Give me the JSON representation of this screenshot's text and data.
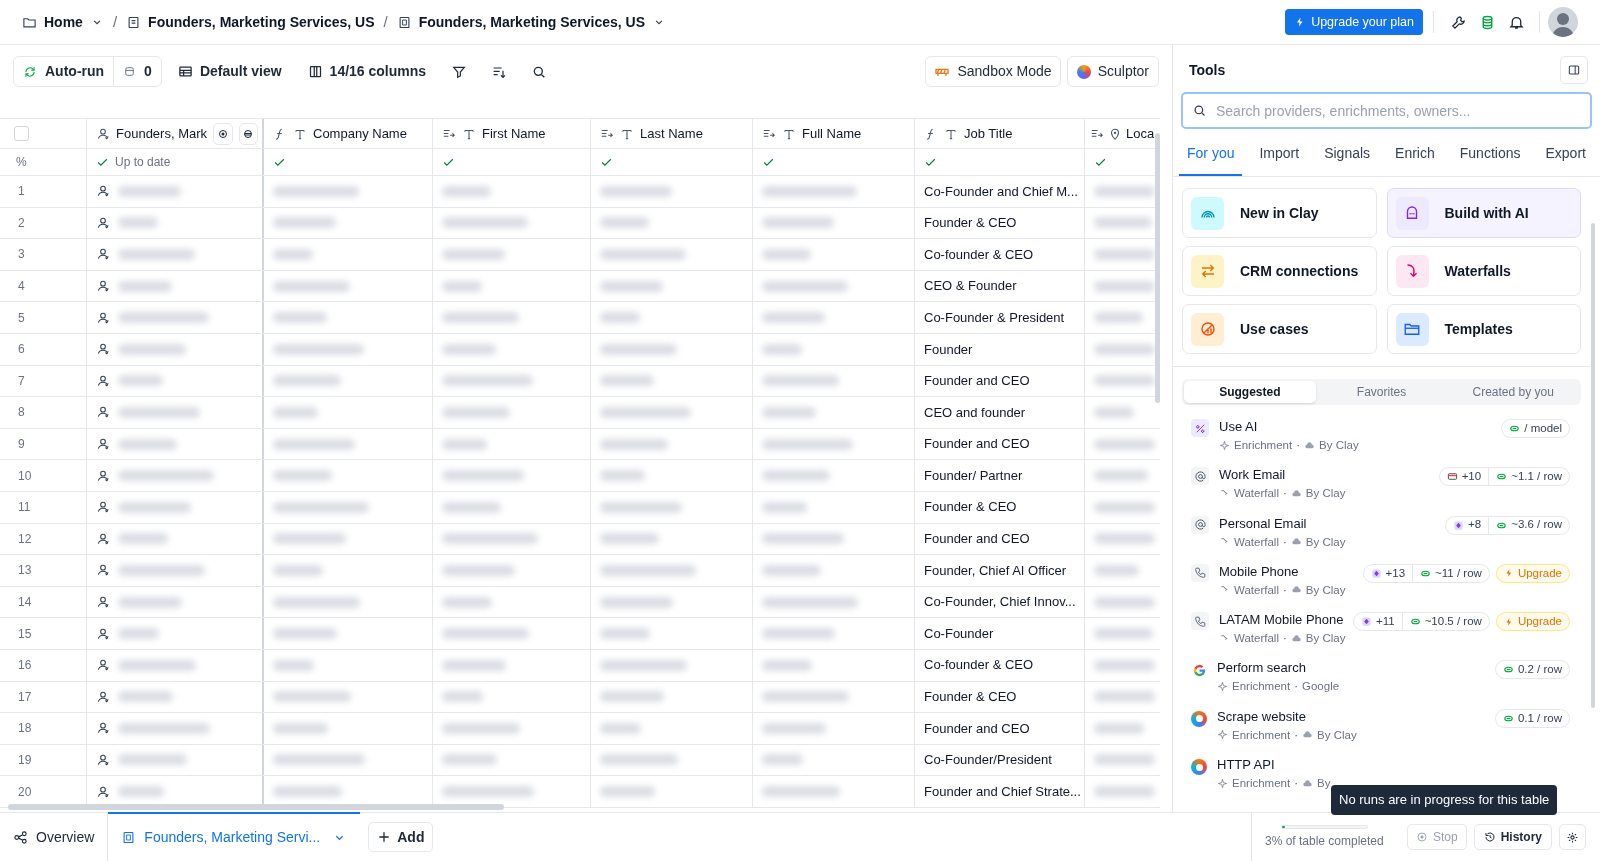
{
  "breadcrumbs": [
    {
      "label": "Home",
      "kind": "folder",
      "dropdown": true
    },
    {
      "separator": "/",
      "label": "Founders, Marketing Services, US",
      "kind": "doc",
      "dropdown": false
    },
    {
      "separator": "/",
      "label": "Founders, Marketing Services, US",
      "kind": "table",
      "dropdown": true
    }
  ],
  "header": {
    "upgrade_button": "Upgrade your plan"
  },
  "toolbar": {
    "auto_run": "Auto-run",
    "queue_count": "0",
    "view": "Default view",
    "columns": "14/16 columns",
    "sandbox": "Sandbox Mode",
    "sculptor": "Sculptor"
  },
  "table": {
    "select_all_checked": false,
    "status_label": "%",
    "columns": [
      {
        "name": "Founders, Mark",
        "kind": "source",
        "done": true,
        "status_text": "Up to date"
      },
      {
        "name": "Company Name",
        "kind": "formula",
        "done": true
      },
      {
        "name": "First Name",
        "kind": "input",
        "done": true
      },
      {
        "name": "Last Name",
        "kind": "input",
        "done": true
      },
      {
        "name": "Full Name",
        "kind": "input",
        "done": true
      },
      {
        "name": "Job Title",
        "kind": "formula",
        "done": true
      },
      {
        "name": "Loca",
        "kind": "location",
        "done": true
      }
    ],
    "rows": [
      {
        "n": "1",
        "job_title": "Co-Founder and Chief M..."
      },
      {
        "n": "2",
        "job_title": "Founder & CEO"
      },
      {
        "n": "3",
        "job_title": "Co-founder & CEO"
      },
      {
        "n": "4",
        "job_title": "CEO & Founder"
      },
      {
        "n": "5",
        "job_title": "Co-Founder & President"
      },
      {
        "n": "6",
        "job_title": "Founder"
      },
      {
        "n": "7",
        "job_title": "Founder and CEO"
      },
      {
        "n": "8",
        "job_title": "CEO and founder"
      },
      {
        "n": "9",
        "job_title": "Founder and CEO"
      },
      {
        "n": "10",
        "job_title": "Founder/ Partner"
      },
      {
        "n": "11",
        "job_title": "Founder & CEO"
      },
      {
        "n": "12",
        "job_title": "Founder and CEO"
      },
      {
        "n": "13",
        "job_title": "Founder, Chief AI Officer"
      },
      {
        "n": "14",
        "job_title": "Co-Founder, Chief Innov..."
      },
      {
        "n": "15",
        "job_title": "Co-Founder"
      },
      {
        "n": "16",
        "job_title": "Co-founder & CEO"
      },
      {
        "n": "17",
        "job_title": "Founder & CEO"
      },
      {
        "n": "18",
        "job_title": "Founder and CEO"
      },
      {
        "n": "19",
        "job_title": "Co-Founder/President"
      },
      {
        "n": "20",
        "job_title": "Founder and Chief Strate..."
      }
    ]
  },
  "tools": {
    "title": "Tools",
    "search": {
      "placeholder": "Search providers, enrichments, owners..."
    },
    "tabs": [
      {
        "label": "For you",
        "selected": true
      },
      {
        "label": "Import",
        "selected": false
      },
      {
        "label": "Signals",
        "selected": false
      },
      {
        "label": "Enrich",
        "selected": false
      },
      {
        "label": "Functions",
        "selected": false
      },
      {
        "label": "Export",
        "selected": false
      }
    ],
    "cards": [
      {
        "label": "New in Clay",
        "kind": "rainbow",
        "highlighted": false
      },
      {
        "label": "Build with AI",
        "kind": "robot",
        "highlighted": true
      },
      {
        "label": "CRM connections",
        "kind": "arrows",
        "highlighted": false
      },
      {
        "label": "Waterfalls",
        "kind": "waterfall",
        "highlighted": false
      },
      {
        "label": "Use cases",
        "kind": "chart",
        "highlighted": false
      },
      {
        "label": "Templates",
        "kind": "folder",
        "highlighted": false
      }
    ],
    "filters": [
      {
        "label": "Suggested",
        "selected": true
      },
      {
        "label": "Favorites",
        "selected": false
      },
      {
        "label": "Created by you",
        "selected": false
      }
    ],
    "items": [
      {
        "name": "Use AI",
        "kind": "ai",
        "type": "Enrichment",
        "dot": "·",
        "source": "By Clay",
        "by_clay": true,
        "badges": [
          {
            "kind": "coin",
            "text": "/ model"
          }
        ]
      },
      {
        "name": "Work Email",
        "kind": "at",
        "type": "Waterfall",
        "dot": "·",
        "source": "By Clay",
        "by_clay": true,
        "badges": [
          {
            "kind": "card",
            "text": "+10"
          },
          {
            "kind": "coin",
            "text": "~1.1 / row"
          }
        ]
      },
      {
        "name": "Personal Email",
        "kind": "at",
        "type": "Waterfall",
        "dot": "·",
        "source": "By Clay",
        "by_clay": true,
        "badges": [
          {
            "kind": "gem",
            "text": "+8"
          },
          {
            "kind": "coin",
            "text": "~3.6 / row"
          }
        ]
      },
      {
        "name": "Mobile Phone",
        "kind": "phone",
        "type": "Waterfall",
        "dot": "·",
        "source": "By Clay",
        "by_clay": true,
        "badges": [
          {
            "kind": "gem",
            "text": "+13"
          },
          {
            "kind": "coin",
            "text": "~11 / row"
          }
        ],
        "upgrade": "Upgrade"
      },
      {
        "name": "LATAM Mobile Phone",
        "kind": "phone",
        "type": "Waterfall",
        "dot": "·",
        "source": "By Clay",
        "by_clay": true,
        "badges": [
          {
            "kind": "gem",
            "text": "+11"
          },
          {
            "kind": "coin",
            "text": "~10.5 / row"
          }
        ],
        "upgrade": "Upgrade"
      },
      {
        "name": "Perform search",
        "kind": "google",
        "type": "Enrichment",
        "dot": "·",
        "source": "Google",
        "by_clay": false,
        "badges": [
          {
            "kind": "coin",
            "text": "0.2 / row"
          }
        ]
      },
      {
        "name": "Scrape website",
        "kind": "clay",
        "type": "Enrichment",
        "dot": "·",
        "source": "By Clay",
        "by_clay": true,
        "badges": [
          {
            "kind": "coin",
            "text": "0.1 / row"
          }
        ]
      },
      {
        "name": "HTTP API",
        "kind": "clay",
        "type": "Enrichment",
        "dot": "·",
        "source": "By",
        "by_clay": true
      }
    ]
  },
  "bottom": {
    "tabs": [
      {
        "label": "Overview",
        "kind": "overview",
        "selected": false
      },
      {
        "label": "Founders, Marketing Servi...",
        "kind": "table",
        "selected": true
      }
    ],
    "add_button": "Add",
    "progress": {
      "level": 0.03,
      "text": "3% of table completed"
    },
    "stop_button": {
      "label": "Stop",
      "disabled": true
    },
    "history_button": "History",
    "tooltip": "No runs are in progress for this table"
  }
}
